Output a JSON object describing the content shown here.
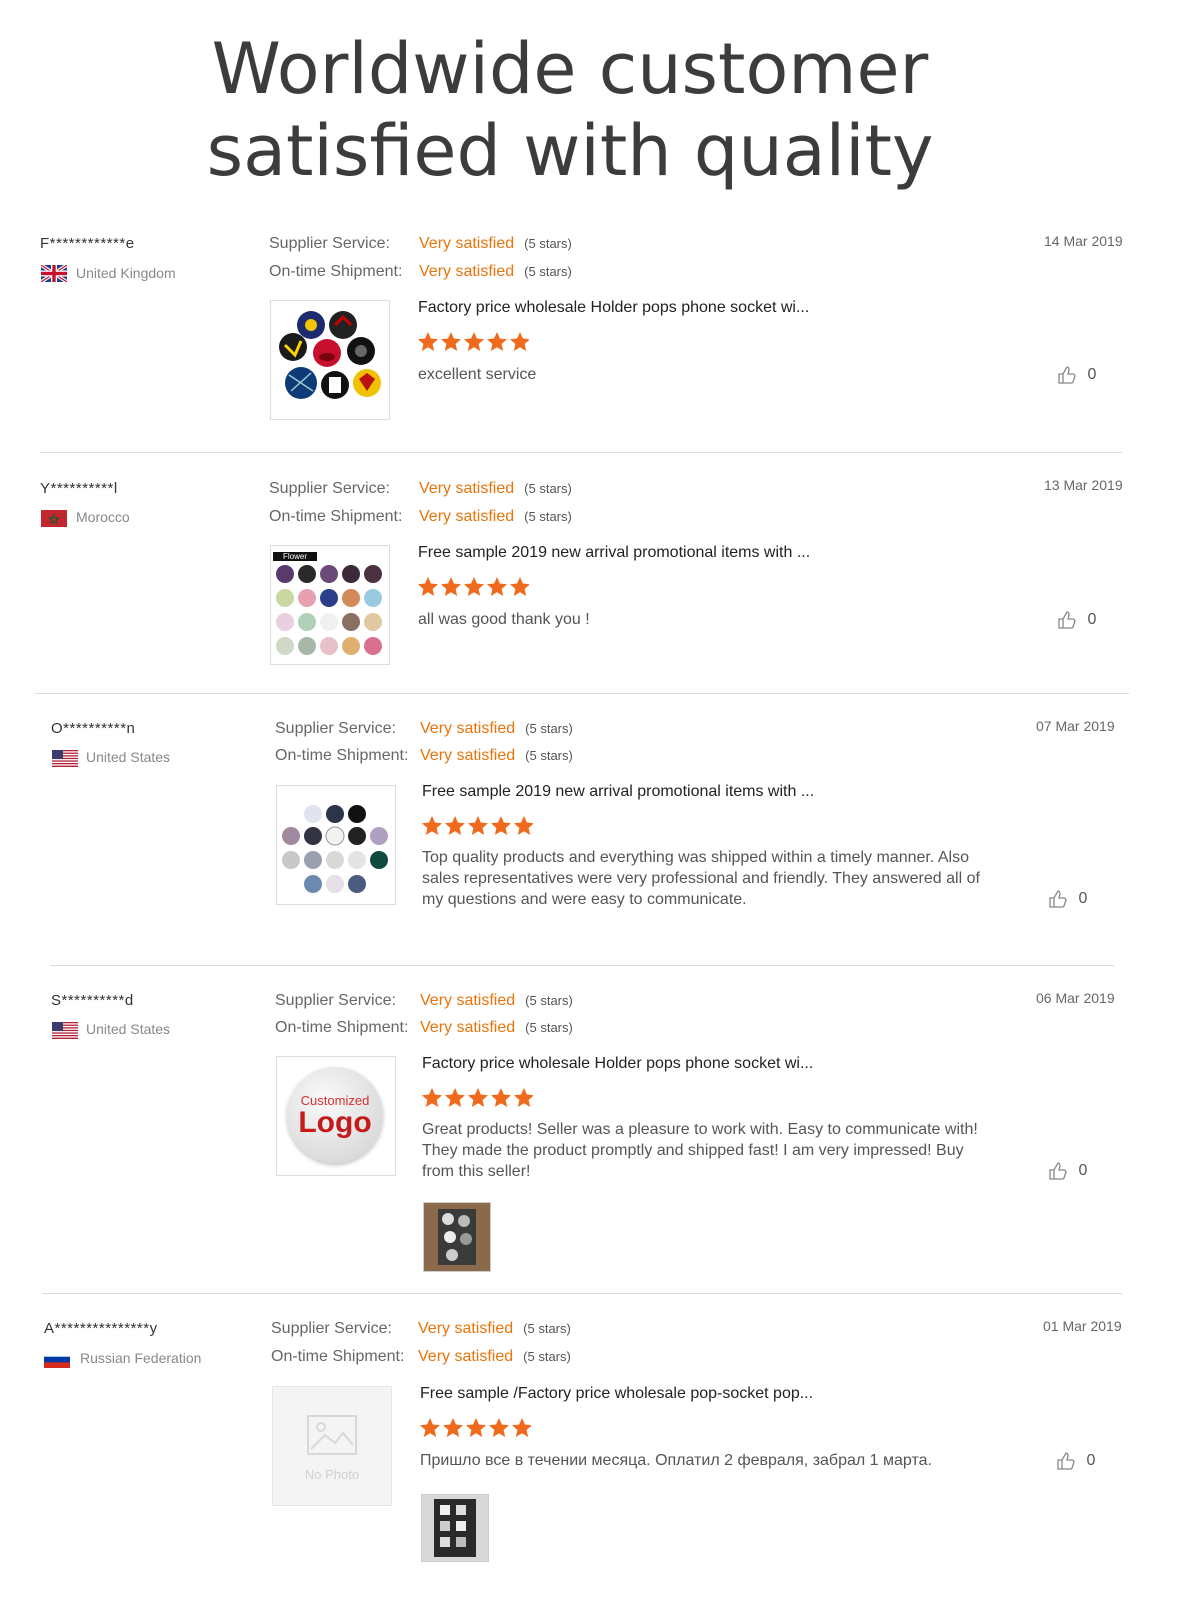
{
  "headline": {
    "line1": "Worldwide customer",
    "line2": "satisfied with quality"
  },
  "labels": {
    "supplier_service": "Supplier Service:",
    "ontime_shipment": "On-time Shipment:",
    "very_satisfied": "Very satisfied",
    "five_stars": "(5 stars)",
    "no_photo": "No Photo"
  },
  "colors": {
    "accent": "#e8740a",
    "star": "#f06a1d",
    "text": "#333333",
    "divider": "#dddddd"
  },
  "reviews": [
    {
      "user": "F************e",
      "country": "United Kingdom",
      "flag_icon": "uk-flag-icon",
      "date": "14 Mar 2019",
      "product_title": "Factory price wholesale Holder pops phone socket wi...",
      "rating": 5,
      "comment": "excellent service",
      "likes": "0"
    },
    {
      "user": "Y**********l",
      "country": "Morocco",
      "flag_icon": "morocco-flag-icon",
      "date": "13 Mar 2019",
      "product_title": "Free sample 2019 new arrival promotional items with ...",
      "rating": 5,
      "comment": "all was good thank you !",
      "likes": "0",
      "thumb_label": "Flower"
    },
    {
      "user": "O**********n",
      "country": "United States",
      "flag_icon": "us-flag-icon",
      "date": "07 Mar 2019",
      "product_title": "Free sample 2019 new arrival promotional items with ...",
      "rating": 5,
      "comment": "Top quality products and everything was shipped within a timely manner. Also sales representatives were very professional and friendly. They answered all of my questions and were easy to communicate.",
      "likes": "0"
    },
    {
      "user": "S**********d",
      "country": "United States",
      "flag_icon": "us-flag-icon",
      "date": "06 Mar 2019",
      "product_title": "Factory price wholesale Holder pops phone socket wi...",
      "rating": 5,
      "comment": "Great products! Seller was a pleasure to work with. Easy to communicate with! They made the product promptly and shipped fast! I am very impressed! Buy from this seller!",
      "likes": "0",
      "thumb_text_small": "Customized",
      "thumb_text_big": "Logo"
    },
    {
      "user": "A***************y",
      "country": "Russian Federation",
      "flag_icon": "russia-flag-icon",
      "date": "01 Mar 2019",
      "product_title": "Free sample /Factory price wholesale pop-socket pop...",
      "rating": 5,
      "comment": "Пришло все в течении месяца. Оплатил 2 февраля, забрал 1 марта.",
      "likes": "0"
    }
  ]
}
